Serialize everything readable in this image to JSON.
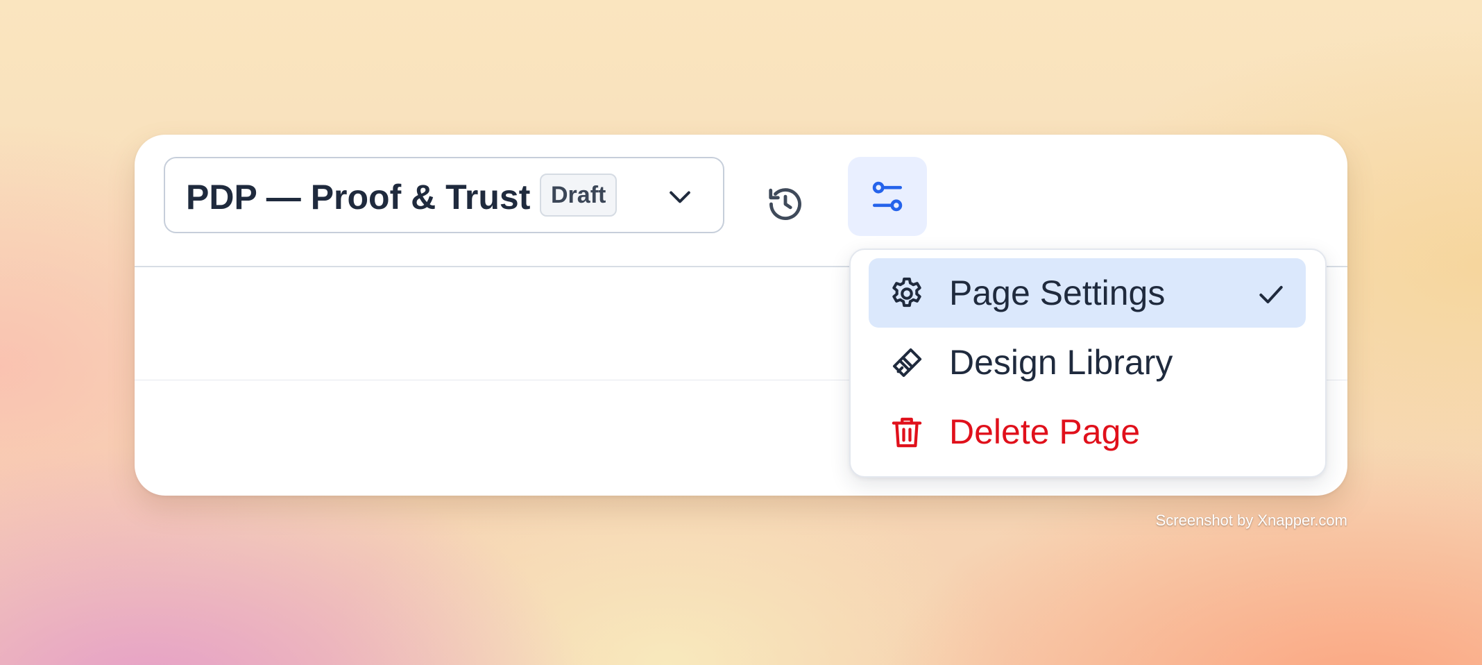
{
  "page_selector": {
    "title": "PDP — Proof & Trust",
    "status": "Draft",
    "icon": "chevron-down-icon"
  },
  "toolbar": {
    "history_icon": "history-icon",
    "settings_icon": "sliders-icon"
  },
  "menu": {
    "items": [
      {
        "label": "Page Settings",
        "icon": "gear-icon",
        "selected": true
      },
      {
        "label": "Design Library",
        "icon": "paintbrush-icon",
        "selected": false
      },
      {
        "label": "Delete Page",
        "icon": "trash-icon",
        "selected": false
      }
    ]
  },
  "colors": {
    "text": "#1f2a3d",
    "accent": "#2563eb",
    "accent_bg": "#e9efff",
    "selected_bg": "#dbe8fc",
    "danger": "#e0101b"
  },
  "watermark": "Screenshot by Xnapper.com"
}
